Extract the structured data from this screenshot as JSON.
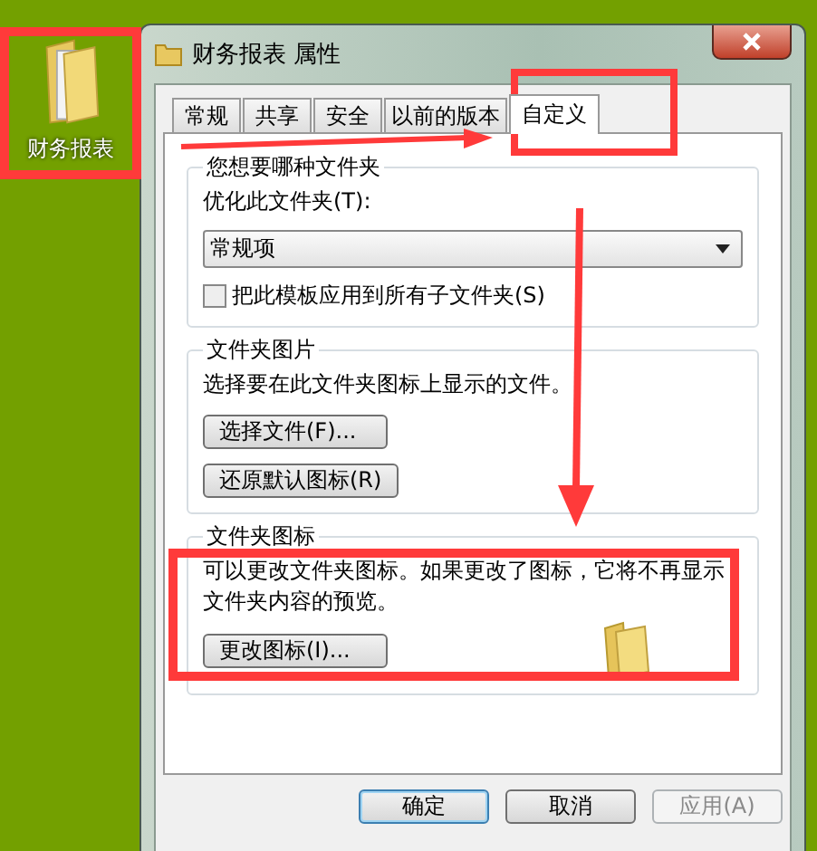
{
  "desktop_icon": {
    "label": "财务报表"
  },
  "window": {
    "title": "财务报表 属性"
  },
  "tabs": [
    {
      "label": "常规",
      "selected": false
    },
    {
      "label": "共享",
      "selected": false
    },
    {
      "label": "安全",
      "selected": false
    },
    {
      "label": "以前的版本",
      "selected": false
    },
    {
      "label": "自定义",
      "selected": true
    }
  ],
  "folder_type": {
    "title": "您想要哪种文件夹",
    "label": "优化此文件夹(T):",
    "dropdown_value": "常规项",
    "checkbox": {
      "label": "把此模板应用到所有子文件夹(S)",
      "checked": false
    }
  },
  "folder_picture": {
    "title": "文件夹图片",
    "description": "选择要在此文件夹图标上显示的文件。",
    "buttons": [
      "选择文件(F)...",
      "还原默认图标(R)"
    ]
  },
  "folder_icon": {
    "title": "文件夹图标",
    "description": "可以更改文件夹图标。如果更改了图标，它将不再显示文件夹内容的预览。",
    "button": "更改图标(I)..."
  },
  "buttons": [
    {
      "label": "确定",
      "kind": "default",
      "disabled": false
    },
    {
      "label": "取消",
      "kind": "normal",
      "disabled": false
    },
    {
      "label": "应用(A)",
      "kind": "normal",
      "disabled": true
    }
  ]
}
